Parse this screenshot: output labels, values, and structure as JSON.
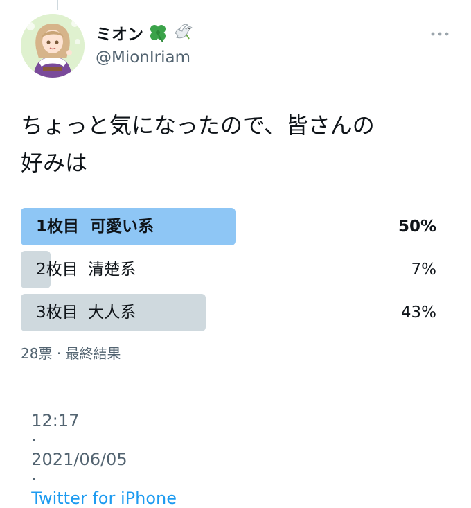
{
  "tweet": {
    "author": {
      "display_name": "ミオン",
      "name_emojis": [
        "four-leaf-clover-icon",
        "dove-icon"
      ],
      "handle": "@MionIriam"
    },
    "text": "ちょっと気になったので、皆さんの\n好みは",
    "poll": {
      "options": [
        {
          "label": "1枚目  可愛い系",
          "percent_text": "50%",
          "percent": 50,
          "winner": true
        },
        {
          "label": "2枚目  清楚系",
          "percent_text": "7%",
          "percent": 7,
          "winner": false
        },
        {
          "label": "3枚目  大人系",
          "percent_text": "43%",
          "percent": 43,
          "winner": false
        }
      ],
      "votes_text": "28票",
      "separator": "·",
      "status_text": "最終結果"
    },
    "meta": {
      "time": "12:17",
      "date": "2021/06/05",
      "separator": "·",
      "source": "Twitter for iPhone"
    }
  },
  "colors": {
    "winner_bar": "#8ec6f5",
    "other_bar": "#cfd9de",
    "link": "#1d9bf0",
    "secondary_text": "#536471"
  }
}
